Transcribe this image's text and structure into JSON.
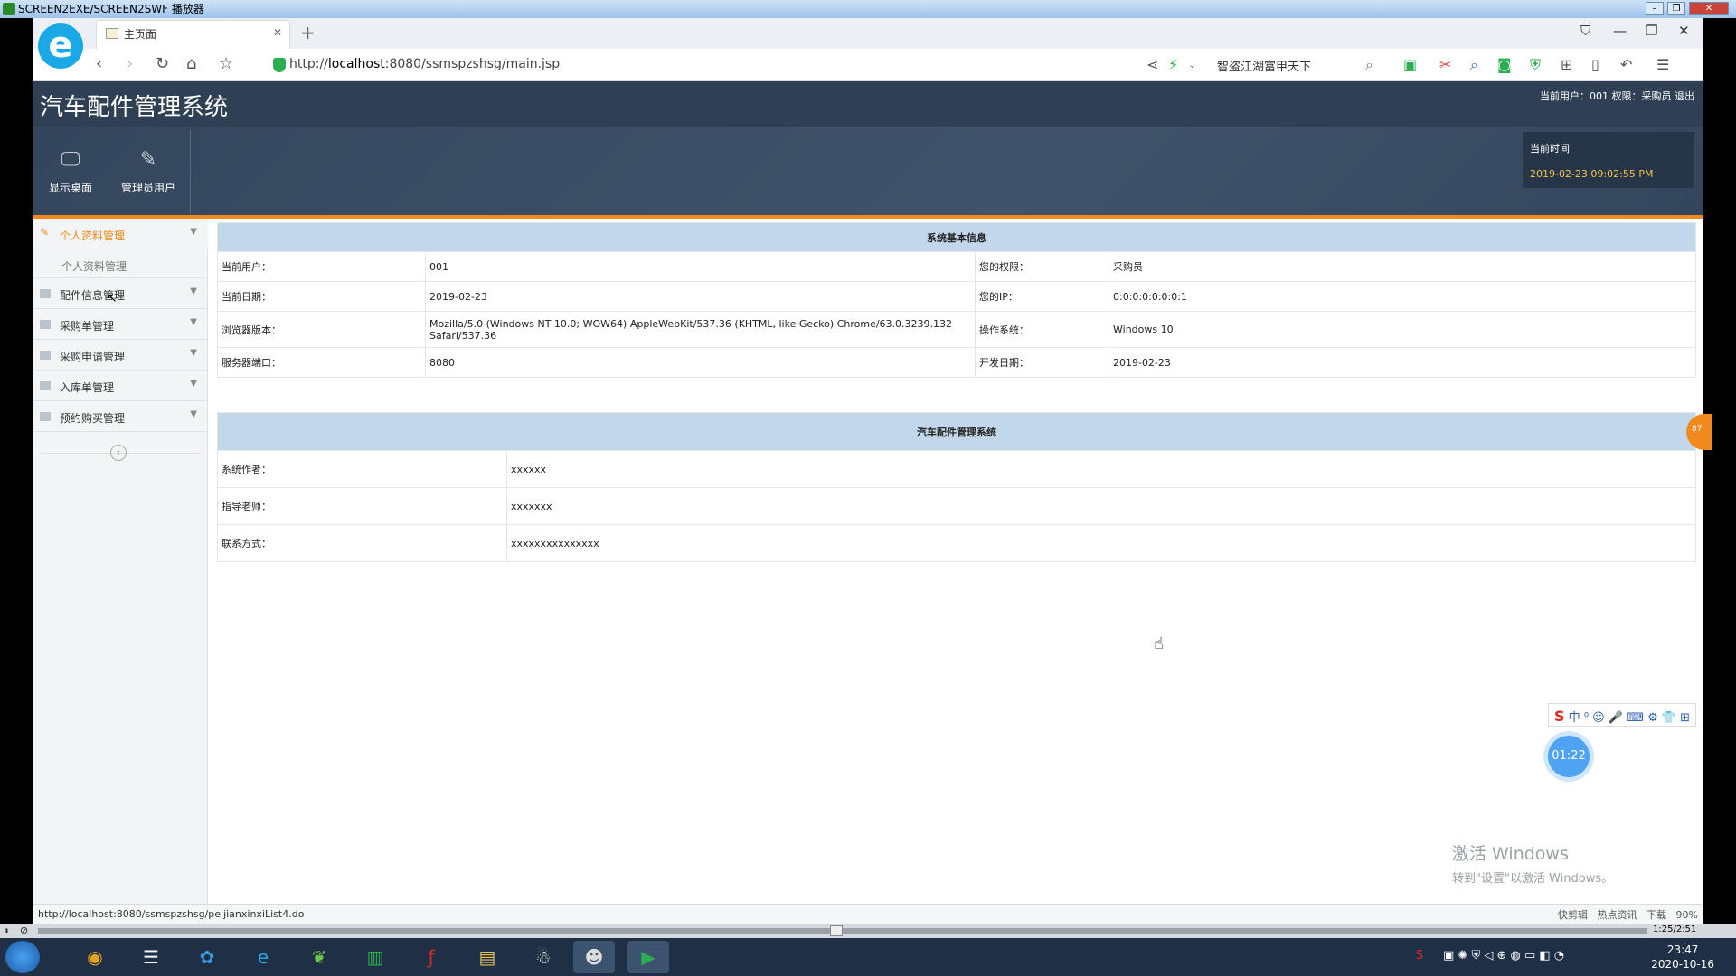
{
  "player": {
    "title": "SCREEN2EXE/SCREEN2SWF 播放器",
    "time": "1:25/2:51"
  },
  "browser": {
    "tab_title": "主页面",
    "url_prefix": "http://",
    "url_host": "localhost",
    "url_rest": ":8080/ssmspzshsg/main.jsp",
    "search_text": "智盗江湖富甲天下",
    "status_url": "http://localhost:8080/ssmspzshsg/peijianxinxiList4.do",
    "status_items": [
      "快剪辑",
      "热点资讯",
      "下载",
      "90%"
    ]
  },
  "app": {
    "system_title": "汽车配件管理系统",
    "user_bar": "当前用户：001  权限：采购员  退出",
    "toolbar": [
      {
        "label": "显示桌面",
        "icon": "monitor-icon"
      },
      {
        "label": "管理员用户",
        "icon": "pencil-icon"
      }
    ],
    "time_label": "当前时间",
    "time_value": "2019-02-23 09:02:55 PM"
  },
  "sidebar": {
    "items": [
      {
        "label": "个人资料管理",
        "sub": "个人资料管理"
      },
      {
        "label": "配件信息管理"
      },
      {
        "label": "采购单管理"
      },
      {
        "label": "采购申请管理"
      },
      {
        "label": "入库单管理"
      },
      {
        "label": "预约购买管理"
      }
    ]
  },
  "sysinfo": {
    "header": "系统基本信息",
    "rows": [
      {
        "l1": "当前用户：",
        "v1": "001",
        "l2": "您的权限：",
        "v2": "采购员"
      },
      {
        "l1": "当前日期：",
        "v1": "2019-02-23",
        "l2": "您的IP：",
        "v2": "0:0:0:0:0:0:0:1"
      },
      {
        "l1": "浏览器版本：",
        "v1": "Mozilla/5.0 (Windows NT 10.0; WOW64) AppleWebKit/537.36 (KHTML, like Gecko) Chrome/63.0.3239.132 Safari/537.36",
        "l2": "操作系统：",
        "v2": "Windows 10"
      },
      {
        "l1": "服务器端口：",
        "v1": "8080",
        "l2": "开发日期：",
        "v2": "2019-02-23"
      }
    ]
  },
  "about": {
    "header": "汽车配件管理系统",
    "rows": [
      {
        "label": "系统作者：",
        "value": "xxxxxx"
      },
      {
        "label": "指导老师：",
        "value": "xxxxxxx"
      },
      {
        "label": "联系方式：",
        "value": "xxxxxxxxxxxxxxx"
      }
    ]
  },
  "overlay": {
    "timer": "01:22",
    "badge": "87",
    "activate_title": "激活 Windows",
    "activate_sub": "转到\"设置\"以激活 Windows。",
    "ime": "中"
  },
  "taskbar": {
    "clock_time": "23:47",
    "clock_date": "2020-10-16"
  }
}
